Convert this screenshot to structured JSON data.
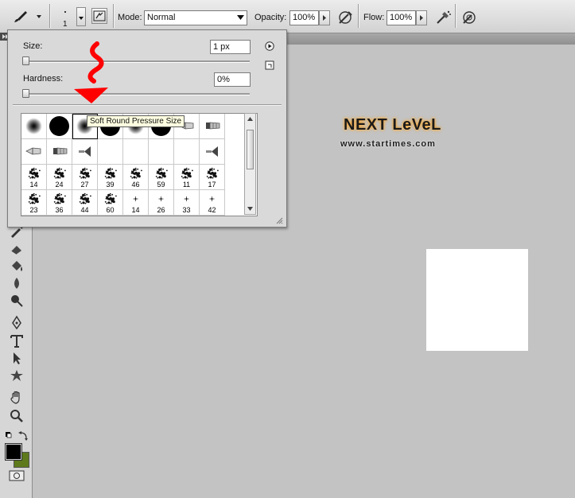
{
  "options_bar": {
    "brush_size_value": "1",
    "mode_label": "Mode:",
    "mode_value": "Normal",
    "opacity_label": "Opacity:",
    "opacity_value": "100%",
    "flow_label": "Flow:",
    "flow_value": "100%"
  },
  "brush_picker": {
    "size_label": "Size:",
    "size_value": "1 px",
    "size_level": 0.0,
    "hardness_label": "Hardness:",
    "hardness_value": "0%",
    "hardness_level": 0.0,
    "tooltip": "Soft Round Pressure Size",
    "rows": [
      [
        {
          "kind": "soft",
          "num": ""
        },
        {
          "kind": "hard",
          "num": ""
        },
        {
          "kind": "soft",
          "num": "",
          "selected": true
        },
        {
          "kind": "hard",
          "num": ""
        },
        {
          "kind": "soft",
          "num": ""
        },
        {
          "kind": "hard",
          "num": ""
        },
        {
          "kind": "bristle",
          "num": ""
        },
        {
          "kind": "flat",
          "num": ""
        }
      ],
      [
        {
          "kind": "bristle",
          "num": ""
        },
        {
          "kind": "flat",
          "num": ""
        },
        {
          "kind": "fan",
          "num": ""
        },
        {
          "kind": "blank",
          "num": ""
        },
        {
          "kind": "blank",
          "num": ""
        },
        {
          "kind": "blank",
          "num": ""
        },
        {
          "kind": "blank",
          "num": ""
        },
        {
          "kind": "fan",
          "num": ""
        }
      ],
      [
        {
          "kind": "splat",
          "num": "14"
        },
        {
          "kind": "splat",
          "num": "24"
        },
        {
          "kind": "splat",
          "num": "27"
        },
        {
          "kind": "splat",
          "num": "39"
        },
        {
          "kind": "splat",
          "num": "46"
        },
        {
          "kind": "splat",
          "num": "59"
        },
        {
          "kind": "splat",
          "num": "11"
        },
        {
          "kind": "splat",
          "num": "17"
        }
      ],
      [
        {
          "kind": "splat",
          "num": "23"
        },
        {
          "kind": "splat",
          "num": "36"
        },
        {
          "kind": "splat",
          "num": "44"
        },
        {
          "kind": "splat",
          "num": "60"
        },
        {
          "kind": "star",
          "num": "14"
        },
        {
          "kind": "star",
          "num": "26"
        },
        {
          "kind": "star",
          "num": "33"
        },
        {
          "kind": "star",
          "num": "42"
        }
      ]
    ]
  },
  "watermark": {
    "title": "NEXT LeVeL",
    "url": "www.startimes.com"
  },
  "colors": {
    "foreground": "#000000",
    "background": "#5e7a1c",
    "arrow": "#ff0000"
  }
}
